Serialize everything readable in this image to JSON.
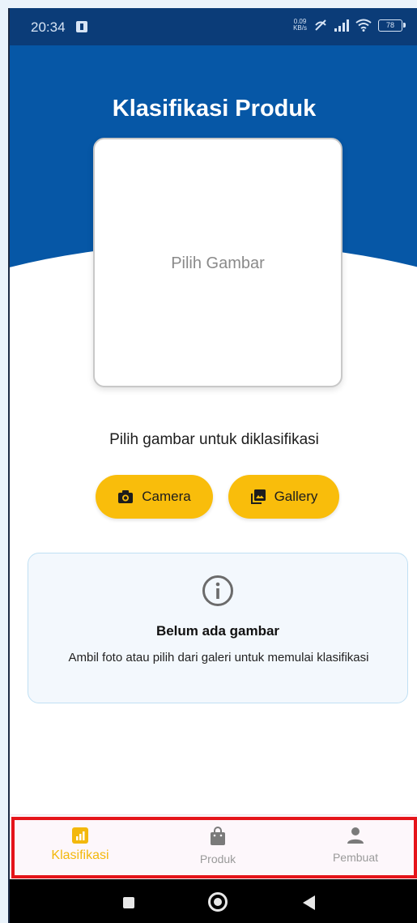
{
  "status_bar": {
    "time": "20:34",
    "net_speed_value": "0.09",
    "net_speed_unit": "KB/s",
    "battery": "78"
  },
  "header": {
    "title": "Klasifikasi Produk"
  },
  "picker": {
    "placeholder": "Pilih Gambar"
  },
  "instruction": "Pilih gambar untuk diklasifikasi",
  "actions": {
    "camera_label": "Camera",
    "gallery_label": "Gallery"
  },
  "info": {
    "title": "Belum ada gambar",
    "description": "Ambil foto atau pilih dari galeri untuk memulai klasifikasi"
  },
  "bottom_nav": {
    "items": [
      {
        "label": "Klasifikasi",
        "icon": "chart-icon",
        "active": true
      },
      {
        "label": "Produk",
        "icon": "shopping-bag-icon",
        "active": false
      },
      {
        "label": "Pembuat",
        "icon": "person-icon",
        "active": false
      }
    ]
  },
  "colors": {
    "primary": "#0657a6",
    "accent": "#f9bd0b",
    "nav_active": "#f3b80c",
    "highlight": "#e5141a"
  }
}
